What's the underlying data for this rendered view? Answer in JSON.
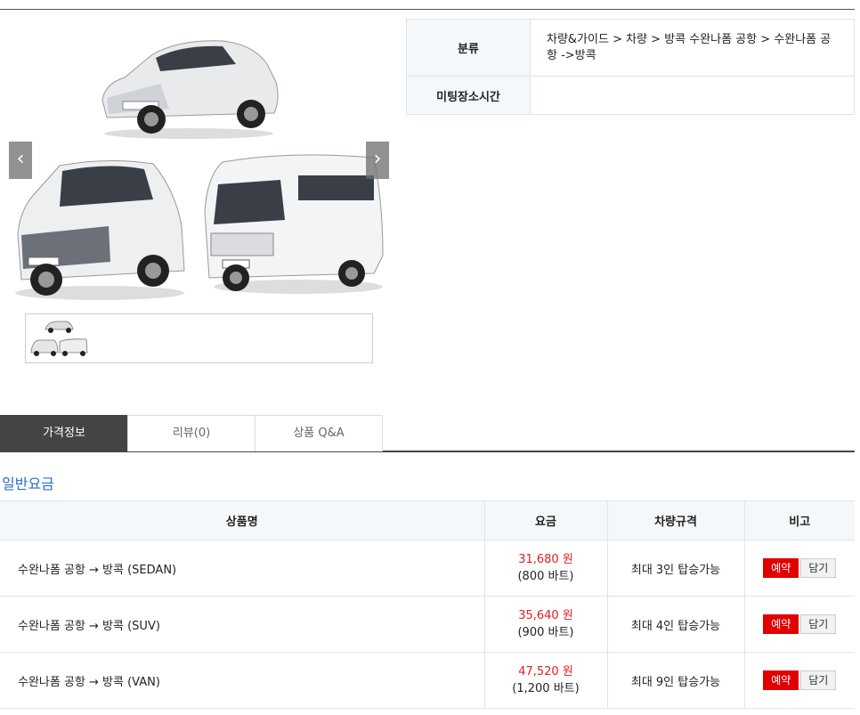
{
  "gallery": {
    "prev_label": "‹",
    "next_label": "›"
  },
  "info": {
    "category_label": "분류",
    "category_value": "차량&가이드 > 차량 > 방콕 수완나폼 공항 > 수완나폼 공항 ->방콕",
    "meeting_label": "미팅장소시간",
    "meeting_value": ""
  },
  "tabs": [
    {
      "label": "가격정보",
      "active": true
    },
    {
      "label": "리뷰(0)",
      "active": false
    },
    {
      "label": "상품 Q&A",
      "active": false
    }
  ],
  "section_title": "일반요금",
  "price_table": {
    "headers": [
      "상품명",
      "요금",
      "차량규격",
      "비고"
    ],
    "rows": [
      {
        "name": "수완나폼 공항 → 방콕 (SEDAN)",
        "won": "31,680 원",
        "baht": "(800 바트)",
        "spec": "최대 3인 탑승가능"
      },
      {
        "name": "수완나폼 공항 → 방콕 (SUV)",
        "won": "35,640 원",
        "baht": "(900 바트)",
        "spec": "최대 4인 탑승가능"
      },
      {
        "name": "수완나폼 공항 → 방콕 (VAN)",
        "won": "47,520 원",
        "baht": "(1,200 바트)",
        "spec": "최대 9인 탑승가능"
      }
    ],
    "book_label": "예약",
    "cart_label": "담기"
  },
  "colors": {
    "accent_blue": "#2a6fc8",
    "price_red": "#e02020",
    "book_red": "#e00000",
    "tab_active": "#444444"
  }
}
